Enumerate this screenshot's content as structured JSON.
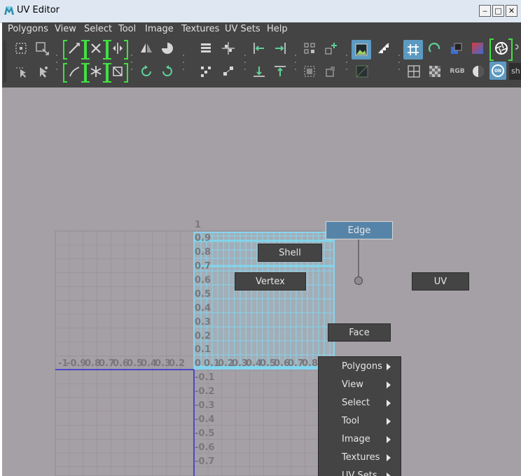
{
  "window": {
    "title": "UV Editor",
    "minimize_glyph": "‒",
    "maximize_glyph": "□",
    "close_glyph": "✕"
  },
  "menubar": {
    "items": [
      "Polygons",
      "View",
      "Select",
      "Tool",
      "Image",
      "Textures",
      "UV Sets",
      "Help"
    ]
  },
  "toolbar": {
    "overflow_label": "sh",
    "rgb_label": "RGB",
    "on_label": "ON",
    "icons": [
      "select-uv-icon",
      "move-uv-icon",
      "lasso-select-icon",
      "tweak-select-icon",
      "cut-uv-icon",
      "sew-uv-icon",
      "unfold-uv-icon",
      "layout-uv-icon",
      "grid-uv-icon",
      "freeze-uv-icon",
      "straighten-uv-icon",
      "flip-uv-icon",
      "rotate-uv-icon",
      "rotate-ccw-icon",
      "rotate-cw-icon",
      "stack-uv-icon",
      "align-uv-icon",
      "align-left-icon",
      "align-right-icon",
      "align-bottom-icon",
      "align-top-icon",
      "distribute-uv-icon",
      "snap-uv-icon",
      "image-display-icon",
      "checker-icon",
      "dim-image-icon",
      "uv-grid-icon",
      "pixel-snap-icon",
      "shaded-uv-icon",
      "texture-border-icon",
      "distortion-icon",
      "filter-icon",
      "rgb-channels-icon",
      "display-alpha-icon",
      "isolate-on-icon"
    ]
  },
  "viewport": {
    "u_axis_labels": [
      "-1",
      "-0.9",
      "0.8",
      "0.7",
      "0.6",
      "0.5",
      "0.4",
      "0.3",
      "0.2",
      "0",
      "0.1",
      "0.2",
      "0.3",
      "0.4",
      "0.5",
      "0.6",
      "0.7",
      "0.8"
    ],
    "v_axis_labels": [
      "1",
      "0.9",
      "0.8",
      "0.7",
      "0.6",
      "0.5",
      "0.4",
      "0.3",
      "0.2",
      "0.1",
      "-0.1",
      "-0.2",
      "-0.3",
      "-0.4",
      "-0.5",
      "-0.6",
      "-0.7"
    ]
  },
  "marking_menu": {
    "edge": "Edge",
    "shell": "Shell",
    "vertex": "Vertex",
    "uv": "UV",
    "face": "Face",
    "selected": "edge"
  },
  "context_menu": {
    "items": [
      "Polygons",
      "View",
      "Select",
      "Tool",
      "Image",
      "Textures",
      "UV Sets"
    ]
  },
  "colors": {
    "viewport_bg": "#a5a0a5",
    "uv_wire": "#7fd6ee",
    "selection_accent": "#5584a8",
    "bracket_green": "#42e042"
  }
}
